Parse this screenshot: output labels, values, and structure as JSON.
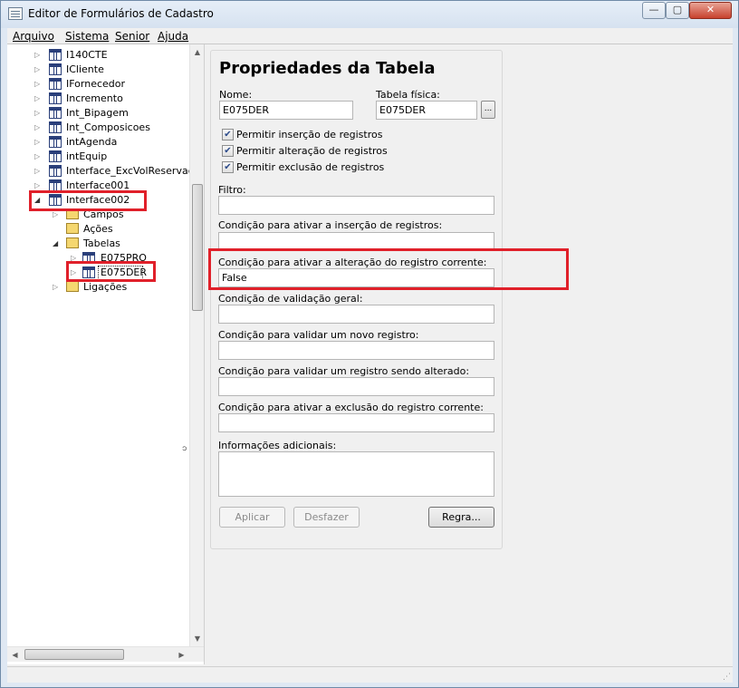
{
  "window": {
    "title": "Editor de Formulários de Cadastro",
    "min_glyph": "—",
    "max_glyph": "▢",
    "close_glyph": "✕"
  },
  "menu": [
    {
      "label": "Arquivo",
      "underline": "A"
    },
    {
      "label": "Sistema",
      "underline": "S"
    },
    {
      "label": "Senior",
      "underline": "S"
    },
    {
      "label": "Ajuda",
      "underline": "j"
    }
  ],
  "tree": {
    "items": [
      {
        "label": "I140CTE",
        "icon": "table-icon",
        "expander": "collapsed"
      },
      {
        "label": "ICliente",
        "icon": "table-icon",
        "expander": "collapsed"
      },
      {
        "label": "IFornecedor",
        "icon": "table-icon",
        "expander": "collapsed"
      },
      {
        "label": "Incremento",
        "icon": "table-icon",
        "expander": "collapsed"
      },
      {
        "label": "Int_Bipagem",
        "icon": "table-icon",
        "expander": "collapsed"
      },
      {
        "label": "Int_Composicoes",
        "icon": "table-icon",
        "expander": "collapsed"
      },
      {
        "label": "intAgenda",
        "icon": "table-icon",
        "expander": "collapsed"
      },
      {
        "label": "intEquip",
        "icon": "table-icon",
        "expander": "collapsed"
      },
      {
        "label": "Interface_ExcVolReservado",
        "icon": "table-icon",
        "expander": "collapsed"
      },
      {
        "label": "Interface001",
        "icon": "table-icon",
        "expander": "collapsed"
      },
      {
        "label": "Interface002",
        "icon": "table-icon",
        "expander": "expanded"
      },
      {
        "label": "Campos",
        "icon": "folder-icon",
        "expander": "collapsed"
      },
      {
        "label": "Ações",
        "icon": "folder-icon",
        "expander": "none"
      },
      {
        "label": "Tabelas",
        "icon": "folder-icon",
        "expander": "expanded"
      },
      {
        "label": "E075PRO",
        "icon": "table-icon",
        "expander": "collapsed"
      },
      {
        "label": "E075DER",
        "icon": "table-icon",
        "expander": "collapsed",
        "selected": true
      },
      {
        "label": "Ligações",
        "icon": "folder-icon",
        "expander": "collapsed"
      }
    ]
  },
  "panel": {
    "title": "Propriedades da Tabela",
    "nome_label": "Nome:",
    "nome_value": "E075DER",
    "tabela_fisica_label": "Tabela física:",
    "tabela_fisica_value": "E075DER",
    "browse_label": "...",
    "checkboxes": [
      {
        "label": "Permitir inserção de registros",
        "checked": true
      },
      {
        "label": "Permitir alteração de registros",
        "checked": true
      },
      {
        "label": "Permitir exclusão de registros",
        "checked": true
      }
    ],
    "filtro_label": "Filtro:",
    "filtro_value": "",
    "cond_insercao_label": "Condição para ativar a inserção de registros:",
    "cond_insercao_value": "",
    "cond_alteracao_label": "Condição para ativar a alteração do registro corrente:",
    "cond_alteracao_value": "False",
    "cond_validacao_label": "Condição de validação geral:",
    "cond_validacao_value": "",
    "cond_novo_label": "Condição para validar um novo registro:",
    "cond_novo_value": "",
    "cond_alterado_label": "Condição para validar um registro sendo alterado:",
    "cond_alterado_value": "",
    "cond_exclusao_label": "Condição para ativar a exclusão do registro corrente:",
    "cond_exclusao_value": "",
    "info_label": "Informações adicionais:",
    "info_value": "",
    "aplicar_label": "Aplicar",
    "desfazer_label": "Desfazer",
    "regra_label": "Regra..."
  },
  "colors": {
    "highlight": "#e0202a",
    "table_icon": "#2a3f7a",
    "folder_icon": "#f5d770"
  }
}
